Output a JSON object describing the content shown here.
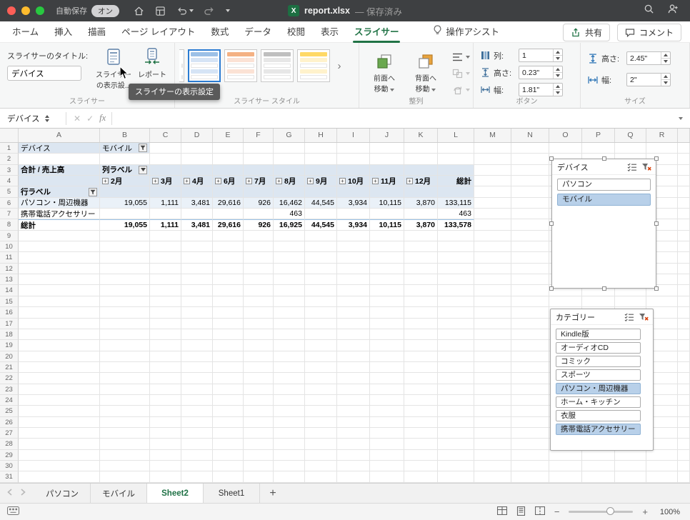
{
  "colors": {
    "excel_green": "#217346",
    "selection_blue": "#2b7cd3",
    "slicer_selected": "#b8d0e9"
  },
  "titlebar": {
    "autosave_label": "自動保存",
    "autosave_state": "オン",
    "filename": "report.xlsx",
    "save_status": "— 保存済み"
  },
  "ribbon_tabs": {
    "tabs": [
      "ホーム",
      "挿入",
      "描画",
      "ページ レイアウト",
      "数式",
      "データ",
      "校閲",
      "表示",
      "スライサー",
      "操作アシスト"
    ],
    "active": "スライサー",
    "share": "共有",
    "comments": "コメント"
  },
  "ribbon": {
    "slicer_group": {
      "caption_label": "スライサーのタイトル:",
      "caption_value": "デバイス",
      "settings_line1": "スライサー",
      "settings_line2": "の表示設...",
      "report_label": "レポート",
      "group_label": "スライサー"
    },
    "styles_group": {
      "group_label": "スライサー スタイル"
    },
    "arrange_group": {
      "bring_forward_line1": "前面へ",
      "bring_forward_line2": "移動",
      "send_backward_line1": "背面へ",
      "send_backward_line2": "移動",
      "group_label": "整列"
    },
    "buttons_group": {
      "group_label": "ボタン",
      "fields": [
        {
          "label": "列:",
          "value": "1"
        },
        {
          "label": "高さ:",
          "value": "0.23\""
        },
        {
          "label": "幅:",
          "value": "1.81\""
        }
      ]
    },
    "size_group": {
      "group_label": "サイズ",
      "fields": [
        {
          "label": "高さ:",
          "value": "2.45\""
        },
        {
          "label": "幅:",
          "value": "2\""
        }
      ]
    },
    "tooltip": "スライサーの表示設定"
  },
  "formula_bar": {
    "name_box": "デバイス",
    "fx_label": "fx"
  },
  "grid": {
    "columns": [
      "A",
      "B",
      "C",
      "D",
      "E",
      "F",
      "G",
      "H",
      "I",
      "J",
      "K",
      "L",
      "M",
      "N",
      "O",
      "P",
      "Q",
      "R"
    ],
    "row_count": 31
  },
  "pivot": {
    "filter_field": "デバイス",
    "filter_value": "モバイル",
    "title": "合計 / 売上高",
    "column_label": "列ラベル",
    "row_label": "行ラベル",
    "months": [
      "2月",
      "3月",
      "4月",
      "6月",
      "7月",
      "8月",
      "9月",
      "10月",
      "11月",
      "12月"
    ],
    "grand_total_label": "総計",
    "data_rows": [
      {
        "label": "パソコン・周辺機器",
        "bold": false,
        "values": [
          "19,055",
          "1,111",
          "3,481",
          "29,616",
          "926",
          "16,462",
          "44,545",
          "3,934",
          "10,115",
          "3,870",
          "133,115"
        ]
      },
      {
        "label": "携帯電話アクセサリー",
        "bold": false,
        "values": [
          "",
          "",
          "",
          "",
          "",
          "463",
          "",
          "",
          "",
          "",
          "463"
        ]
      },
      {
        "label": "総計",
        "bold": true,
        "values": [
          "19,055",
          "1,111",
          "3,481",
          "29,616",
          "926",
          "16,925",
          "44,545",
          "3,934",
          "10,115",
          "3,870",
          "133,578"
        ]
      }
    ]
  },
  "slicers": [
    {
      "title": "デバイス",
      "items": [
        {
          "label": "パソコン",
          "selected": false
        },
        {
          "label": "モバイル",
          "selected": true
        }
      ]
    },
    {
      "title": "カテゴリー",
      "items": [
        {
          "label": "Kindle版",
          "selected": false
        },
        {
          "label": "オーディオCD",
          "selected": false
        },
        {
          "label": "コミック",
          "selected": false
        },
        {
          "label": "スポーツ",
          "selected": false
        },
        {
          "label": "パソコン・周辺機器",
          "selected": true
        },
        {
          "label": "ホーム・キッチン",
          "selected": false
        },
        {
          "label": "衣服",
          "selected": false
        },
        {
          "label": "携帯電話アクセサリー",
          "selected": true
        }
      ]
    }
  ],
  "sheet_tabs": {
    "tabs": [
      "パソコン",
      "モバイル",
      "Sheet2",
      "Sheet1"
    ],
    "active": "Sheet2",
    "add_label": "+"
  },
  "status_bar": {
    "zoom": "100%"
  }
}
